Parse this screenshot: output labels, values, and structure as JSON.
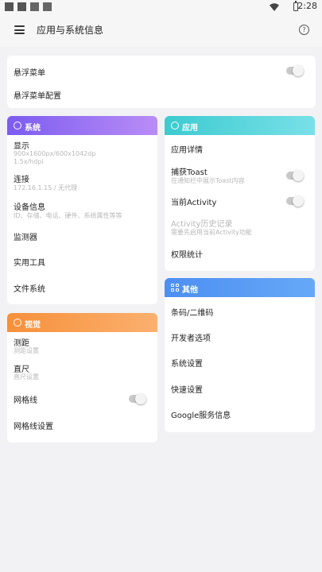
{
  "status_bar": {
    "time": "2:28",
    "icons": [
      "notification-square-icon",
      "notification-square-icon",
      "image-icon",
      "photo-icon",
      "wifi-icon",
      "battery-charging-icon"
    ]
  },
  "app_bar": {
    "title": "应用与系统信息",
    "menu_icon": "menu-icon",
    "help_icon": "help-icon",
    "help_glyph": "?"
  },
  "float_card": {
    "items": [
      {
        "label": "悬浮菜单",
        "toggle": false
      },
      {
        "label": "悬浮菜单配置"
      }
    ]
  },
  "system_card": {
    "title": "系统",
    "icon": "smiley-icon",
    "items": [
      {
        "label": "显示",
        "sub": "900x1600px/600x1042dp",
        "sub2": "1.5x/hdpi"
      },
      {
        "label": "连接",
        "sub": "172.16.1.15 / 无代理"
      },
      {
        "label": "设备信息",
        "sub": "ID、存储、电话、硬件、系统属性等等"
      },
      {
        "label": "监测器"
      },
      {
        "label": "实用工具"
      },
      {
        "label": "文件系统"
      }
    ]
  },
  "app_card": {
    "title": "应用",
    "icon": "app-store-icon",
    "items": [
      {
        "label": "应用详情"
      },
      {
        "label": "捕获Toast",
        "sub": "在通知栏中展示Toast内容",
        "toggle": false
      },
      {
        "label": "当前Activity",
        "toggle": false
      },
      {
        "label": "Activity历史记录",
        "sub": "需要先启用当前Activity功能",
        "disabled": true
      },
      {
        "label": "权限统计"
      }
    ]
  },
  "visual_card": {
    "title": "视觉",
    "icon": "no-edit-icon",
    "items": [
      {
        "label": "测距",
        "sub": "测距设置"
      },
      {
        "label": "直尺",
        "sub": "直尺设置"
      },
      {
        "label": "网格线",
        "toggle": false
      },
      {
        "label": "网格线设置"
      }
    ]
  },
  "other_card": {
    "title": "其他",
    "icon": "grid-icon",
    "items": [
      {
        "label": "条码/二维码"
      },
      {
        "label": "开发者选项"
      },
      {
        "label": "系统设置"
      },
      {
        "label": "快速设置"
      },
      {
        "label": "Google服务信息"
      }
    ]
  }
}
